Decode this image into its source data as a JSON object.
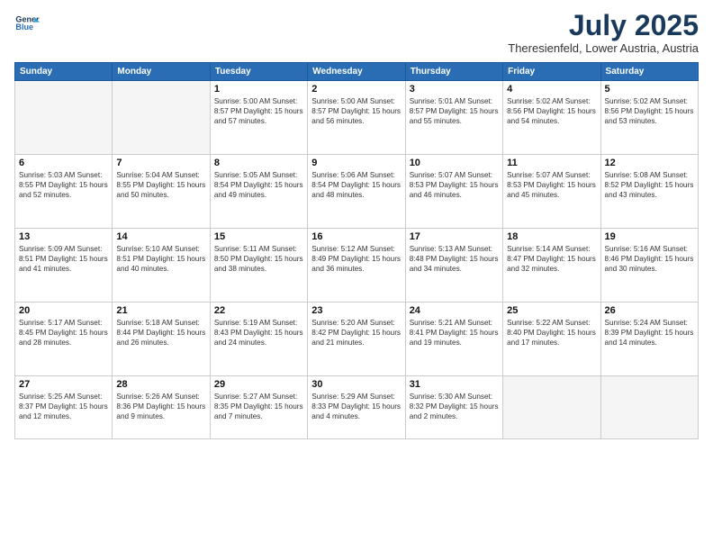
{
  "header": {
    "logo_line1": "General",
    "logo_line2": "Blue",
    "month": "July 2025",
    "location": "Theresienfeld, Lower Austria, Austria"
  },
  "weekdays": [
    "Sunday",
    "Monday",
    "Tuesday",
    "Wednesday",
    "Thursday",
    "Friday",
    "Saturday"
  ],
  "weeks": [
    [
      {
        "day": "",
        "info": ""
      },
      {
        "day": "",
        "info": ""
      },
      {
        "day": "1",
        "info": "Sunrise: 5:00 AM\nSunset: 8:57 PM\nDaylight: 15 hours\nand 57 minutes."
      },
      {
        "day": "2",
        "info": "Sunrise: 5:00 AM\nSunset: 8:57 PM\nDaylight: 15 hours\nand 56 minutes."
      },
      {
        "day": "3",
        "info": "Sunrise: 5:01 AM\nSunset: 8:57 PM\nDaylight: 15 hours\nand 55 minutes."
      },
      {
        "day": "4",
        "info": "Sunrise: 5:02 AM\nSunset: 8:56 PM\nDaylight: 15 hours\nand 54 minutes."
      },
      {
        "day": "5",
        "info": "Sunrise: 5:02 AM\nSunset: 8:56 PM\nDaylight: 15 hours\nand 53 minutes."
      }
    ],
    [
      {
        "day": "6",
        "info": "Sunrise: 5:03 AM\nSunset: 8:55 PM\nDaylight: 15 hours\nand 52 minutes."
      },
      {
        "day": "7",
        "info": "Sunrise: 5:04 AM\nSunset: 8:55 PM\nDaylight: 15 hours\nand 50 minutes."
      },
      {
        "day": "8",
        "info": "Sunrise: 5:05 AM\nSunset: 8:54 PM\nDaylight: 15 hours\nand 49 minutes."
      },
      {
        "day": "9",
        "info": "Sunrise: 5:06 AM\nSunset: 8:54 PM\nDaylight: 15 hours\nand 48 minutes."
      },
      {
        "day": "10",
        "info": "Sunrise: 5:07 AM\nSunset: 8:53 PM\nDaylight: 15 hours\nand 46 minutes."
      },
      {
        "day": "11",
        "info": "Sunrise: 5:07 AM\nSunset: 8:53 PM\nDaylight: 15 hours\nand 45 minutes."
      },
      {
        "day": "12",
        "info": "Sunrise: 5:08 AM\nSunset: 8:52 PM\nDaylight: 15 hours\nand 43 minutes."
      }
    ],
    [
      {
        "day": "13",
        "info": "Sunrise: 5:09 AM\nSunset: 8:51 PM\nDaylight: 15 hours\nand 41 minutes."
      },
      {
        "day": "14",
        "info": "Sunrise: 5:10 AM\nSunset: 8:51 PM\nDaylight: 15 hours\nand 40 minutes."
      },
      {
        "day": "15",
        "info": "Sunrise: 5:11 AM\nSunset: 8:50 PM\nDaylight: 15 hours\nand 38 minutes."
      },
      {
        "day": "16",
        "info": "Sunrise: 5:12 AM\nSunset: 8:49 PM\nDaylight: 15 hours\nand 36 minutes."
      },
      {
        "day": "17",
        "info": "Sunrise: 5:13 AM\nSunset: 8:48 PM\nDaylight: 15 hours\nand 34 minutes."
      },
      {
        "day": "18",
        "info": "Sunrise: 5:14 AM\nSunset: 8:47 PM\nDaylight: 15 hours\nand 32 minutes."
      },
      {
        "day": "19",
        "info": "Sunrise: 5:16 AM\nSunset: 8:46 PM\nDaylight: 15 hours\nand 30 minutes."
      }
    ],
    [
      {
        "day": "20",
        "info": "Sunrise: 5:17 AM\nSunset: 8:45 PM\nDaylight: 15 hours\nand 28 minutes."
      },
      {
        "day": "21",
        "info": "Sunrise: 5:18 AM\nSunset: 8:44 PM\nDaylight: 15 hours\nand 26 minutes."
      },
      {
        "day": "22",
        "info": "Sunrise: 5:19 AM\nSunset: 8:43 PM\nDaylight: 15 hours\nand 24 minutes."
      },
      {
        "day": "23",
        "info": "Sunrise: 5:20 AM\nSunset: 8:42 PM\nDaylight: 15 hours\nand 21 minutes."
      },
      {
        "day": "24",
        "info": "Sunrise: 5:21 AM\nSunset: 8:41 PM\nDaylight: 15 hours\nand 19 minutes."
      },
      {
        "day": "25",
        "info": "Sunrise: 5:22 AM\nSunset: 8:40 PM\nDaylight: 15 hours\nand 17 minutes."
      },
      {
        "day": "26",
        "info": "Sunrise: 5:24 AM\nSunset: 8:39 PM\nDaylight: 15 hours\nand 14 minutes."
      }
    ],
    [
      {
        "day": "27",
        "info": "Sunrise: 5:25 AM\nSunset: 8:37 PM\nDaylight: 15 hours\nand 12 minutes."
      },
      {
        "day": "28",
        "info": "Sunrise: 5:26 AM\nSunset: 8:36 PM\nDaylight: 15 hours\nand 9 minutes."
      },
      {
        "day": "29",
        "info": "Sunrise: 5:27 AM\nSunset: 8:35 PM\nDaylight: 15 hours\nand 7 minutes."
      },
      {
        "day": "30",
        "info": "Sunrise: 5:29 AM\nSunset: 8:33 PM\nDaylight: 15 hours\nand 4 minutes."
      },
      {
        "day": "31",
        "info": "Sunrise: 5:30 AM\nSunset: 8:32 PM\nDaylight: 15 hours\nand 2 minutes."
      },
      {
        "day": "",
        "info": ""
      },
      {
        "day": "",
        "info": ""
      }
    ]
  ]
}
